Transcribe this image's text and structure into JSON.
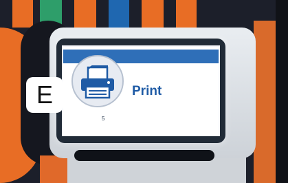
{
  "badge": {
    "letter": "E"
  },
  "screen": {
    "title": "Print",
    "subtext": "5",
    "accent_color": "#2f6fb8",
    "title_color": "#1f5ba5",
    "icon": "printer-icon"
  },
  "background": {
    "stripe_colors": [
      "#e86d25",
      "#2e9e6a",
      "#e86d25",
      "#1f67b0",
      "#e86d25",
      "#e86d25"
    ]
  }
}
